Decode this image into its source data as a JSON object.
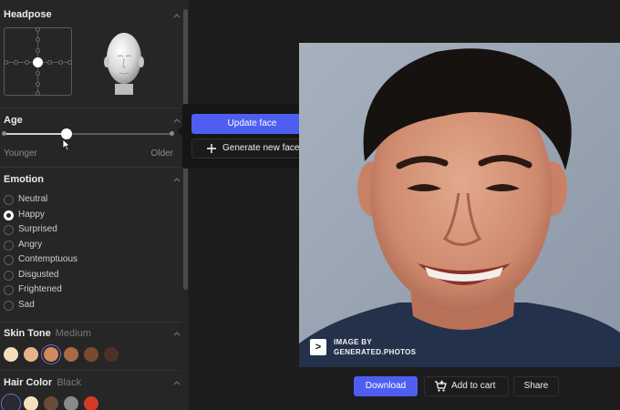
{
  "headpose": {
    "title": "Headpose"
  },
  "age": {
    "title": "Age",
    "min_label": "Younger",
    "max_label": "Older",
    "value_fraction": 0.37
  },
  "emotion": {
    "title": "Emotion",
    "options": [
      "Neutral",
      "Happy",
      "Surprised",
      "Angry",
      "Contemptuous",
      "Disgusted",
      "Frightened",
      "Sad"
    ],
    "selected": "Happy"
  },
  "skin_tone": {
    "title": "Skin Tone",
    "selected_label": "Medium",
    "swatches": [
      "#f5ddb8",
      "#e7b48a",
      "#d08a5c",
      "#a86a45",
      "#7a4a30",
      "#4d3127"
    ]
  },
  "hair_color": {
    "title": "Hair Color",
    "selected_label": "Black",
    "swatches": [
      "#2a2a33",
      "#f4e2bd",
      "#6a4a3a",
      "#8a8a8a",
      "#d23a24"
    ]
  },
  "popup": {
    "update_label": "Update face",
    "generate_label": "Generate new face"
  },
  "watermark": {
    "line1": "IMAGE BY",
    "line2": "GENERATED.PHOTOS",
    "logo_glyph": ">"
  },
  "actions": {
    "download": "Download",
    "add_to_cart": "Add to cart",
    "share": "Share"
  },
  "colors": {
    "accent": "#4d5ef1",
    "sidebar_bg": "#262627",
    "page_bg": "#1c1c1d",
    "photo_bg": "#9aa6b5"
  }
}
